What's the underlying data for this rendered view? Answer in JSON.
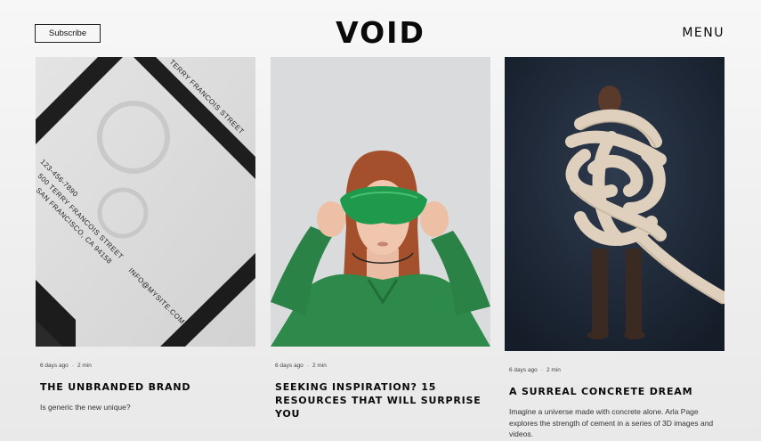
{
  "header": {
    "subscribe_label": "Subscribe",
    "logo": "VOID",
    "menu_label": "MENU"
  },
  "posts": [
    {
      "image": "business-card-mockup",
      "card_text": {
        "street_top": "TERRY FRANCOIS STREET",
        "city_top": "SAN FRANCISCO, CA 94158",
        "phone": "123-456-7890",
        "street": "500 TERRY FRANCOIS STREET",
        "city": "SAN FRANCISCO, CA 94158",
        "email": "INFO@MYSITE.COM"
      },
      "age": "6 days ago",
      "read_time": "2 min",
      "title": "THE UNBRANDED BRAND",
      "excerpt": "Is generic the new unique?"
    },
    {
      "image": "woman-green-sleep-mask",
      "age": "6 days ago",
      "read_time": "2 min",
      "title": "SEEKING INSPIRATION? 15 RESOURCES THAT WILL SURPRISE YOU",
      "excerpt": ""
    },
    {
      "image": "man-wrapped-in-concrete-tubes",
      "age": "6 days ago",
      "read_time": "2 min",
      "title": "A SURREAL CONCRETE DREAM",
      "excerpt": "Imagine a universe made with concrete alone. Arla Page explores the strength of cement in a series of 3D images and videos."
    }
  ],
  "colors": {
    "background": "#f2f2f2",
    "text": "#111111",
    "card2_bg": "#d9dbdc",
    "card2_shirt": "#2d8a4a",
    "card3_bg": "#1f2b3c"
  }
}
